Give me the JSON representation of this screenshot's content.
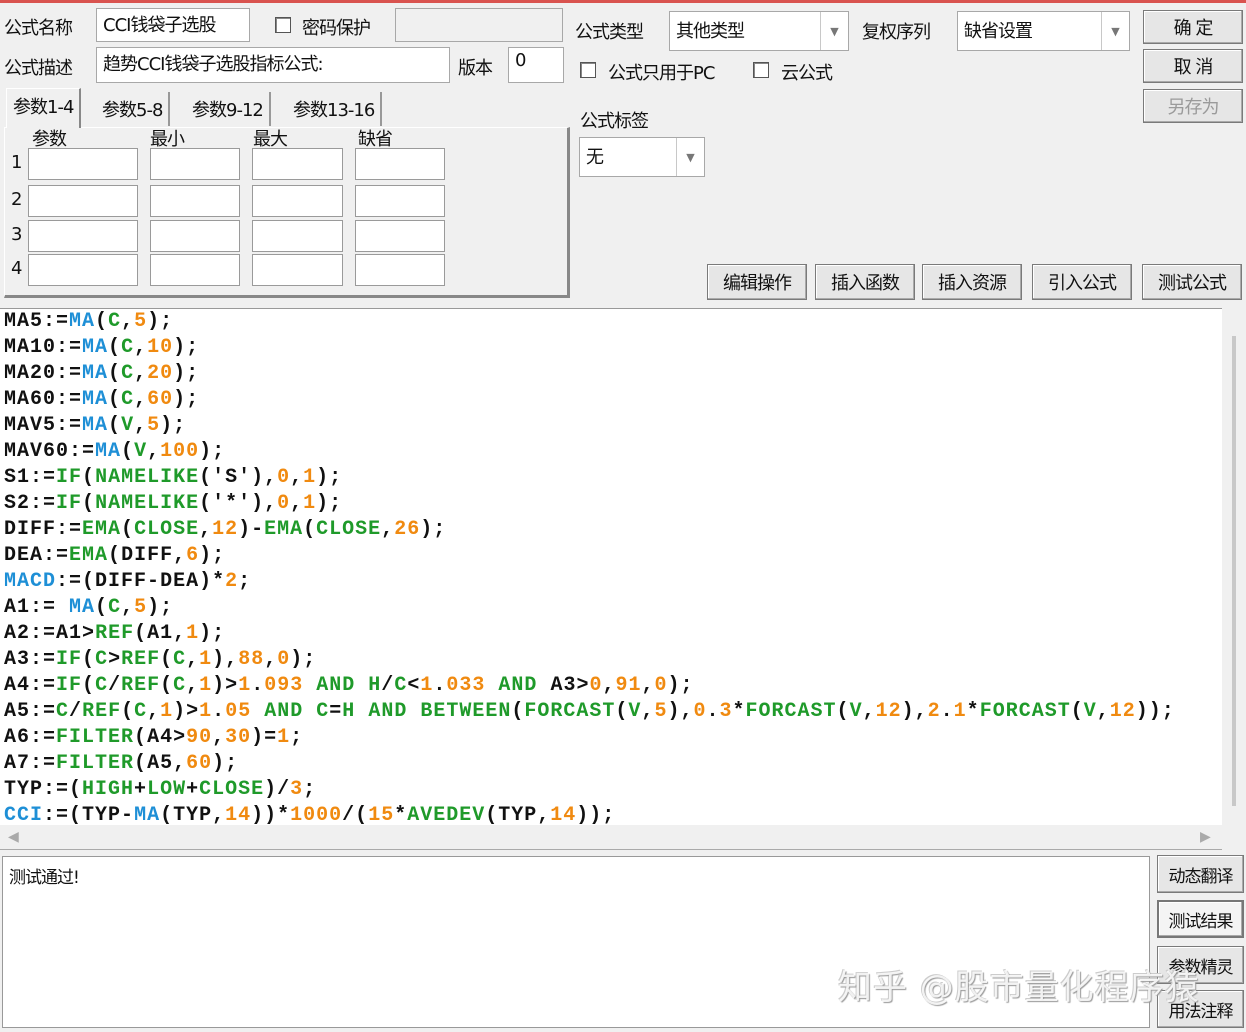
{
  "form": {
    "name_label": "公式名称",
    "name_value": "CCI钱袋子选股",
    "password_label": "密码保护",
    "password_value": "",
    "desc_label": "公式描述",
    "desc_value": "趋势CCI钱袋子选股指标公式:",
    "version_label": "版本",
    "version_value": "0",
    "type_label": "公式类型",
    "type_value": "其他类型",
    "rights_label": "复权序列",
    "rights_value": "缺省设置",
    "pc_only_label": "公式只用于PC",
    "cloud_label": "云公式",
    "tag_label": "公式标签",
    "tag_value": "无"
  },
  "buttons": {
    "ok": "确 定",
    "cancel": "取 消",
    "save_as": "另存为"
  },
  "tabs": [
    "参数1-4",
    "参数5-8",
    "参数9-12",
    "参数13-16"
  ],
  "params": {
    "headers": [
      "参数",
      "最小",
      "最大",
      "缺省"
    ],
    "rows": [
      "1",
      "2",
      "3",
      "4"
    ]
  },
  "toolbar": [
    "编辑操作",
    "插入函数",
    "插入资源",
    "引入公式",
    "测试公式"
  ],
  "code_lines": [
    "MA5:=MA(C,5);",
    "MA10:=MA(C,10);",
    "MA20:=MA(C,20);",
    "MA60:=MA(C,60);",
    "MAV5:=MA(V,5);",
    "MAV60:=MA(V,100);",
    "S1:=IF(NAMELIKE('S'),0,1);",
    "S2:=IF(NAMELIKE('*'),0,1);",
    "DIFF:=EMA(CLOSE,12)-EMA(CLOSE,26);",
    "DEA:=EMA(DIFF,6);",
    "MACD:=(DIFF-DEA)*2;",
    "A1:= MA(C,5);",
    "A2:=A1>REF(A1,1);",
    "A3:=IF(C>REF(C,1),88,0);",
    "A4:=IF(C/REF(C,1)>1.093 AND H/C<1.033 AND A3>0,91,0);",
    "A5:=C/REF(C,1)>1.05 AND C=H AND BETWEEN(FORCAST(V,5),0.3*FORCAST(V,12),2.1*FORCAST(V,12));",
    "A6:=FILTER(A4>90,30)=1;",
    "A7:=FILTER(A5,60);",
    "TYP:=(HIGH+LOW+CLOSE)/3;",
    "CCI:=(TYP-MA(TYP,14))*1000/(15*AVEDEV(TYP,14));"
  ],
  "syntax_colors": {
    "function": "#1f9a2a",
    "highlight": "#1e8fd6",
    "number": "#f08a10",
    "plain": "#111111"
  },
  "output": {
    "text": "测试通过!"
  },
  "side_buttons": [
    "动态翻译",
    "测试结果",
    "参数精灵",
    "用法注释"
  ],
  "watermark": "知乎 @股市量化程序猿"
}
